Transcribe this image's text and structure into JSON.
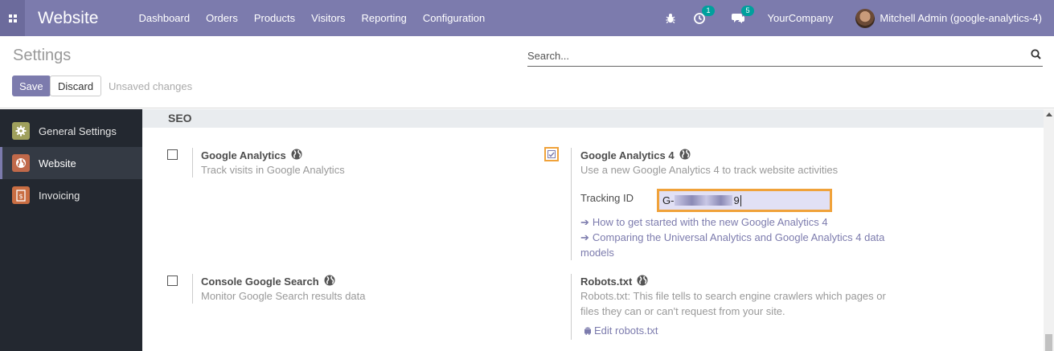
{
  "navbar": {
    "app_name": "Website",
    "menu": [
      "Dashboard",
      "Orders",
      "Products",
      "Visitors",
      "Reporting",
      "Configuration"
    ],
    "activity_badge": "1",
    "messages_badge": "5",
    "company": "YourCompany",
    "user": "Mitchell Admin (google-analytics-4)",
    "brand_color": "#7c7bad"
  },
  "control": {
    "title": "Settings",
    "search_placeholder": "Search...",
    "save_label": "Save",
    "discard_label": "Discard",
    "status": "Unsaved changes"
  },
  "sidebar": {
    "items": [
      {
        "label": "General Settings",
        "icon": "gear-icon"
      },
      {
        "label": "Website",
        "icon": "globe-icon"
      },
      {
        "label": "Invoicing",
        "icon": "invoice-icon"
      }
    ]
  },
  "seo": {
    "section_title": "SEO",
    "google_analytics": {
      "title": "Google Analytics",
      "description": "Track visits in Google Analytics",
      "checked": false
    },
    "google_analytics_4": {
      "title": "Google Analytics 4",
      "description": "Use a new Google Analytics 4 to track website activities",
      "checked": true,
      "tracking_label": "Tracking ID",
      "tracking_prefix": "G-",
      "tracking_suffix": "9",
      "link_1": "How to get started with the new Google Analytics 4",
      "link_2a": "Comparing the Universal Analytics and Google Analytics 4 data",
      "link_2b": "models"
    },
    "console_google_search": {
      "title": "Console Google Search",
      "description": "Monitor Google Search results data",
      "checked": false
    },
    "robots": {
      "title": "Robots.txt",
      "description_1": "Robots.txt: This file tells to search engine crawlers which pages or",
      "description_2": "files they can or can't request from your site.",
      "edit_link": "Edit robots.txt"
    }
  }
}
